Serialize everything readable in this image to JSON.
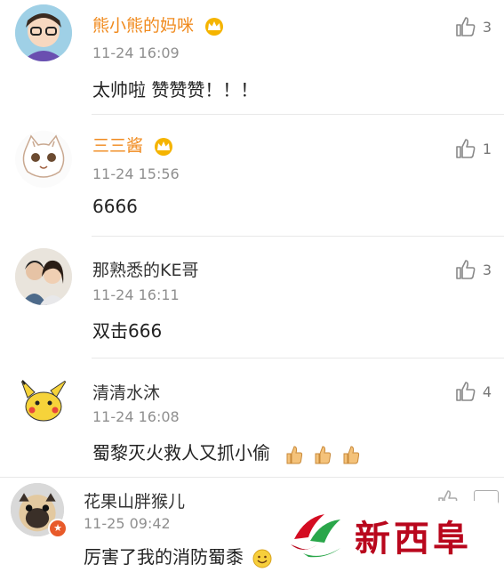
{
  "comments": [
    {
      "name": "熊小熊的妈咪",
      "vip": true,
      "time": "11-24 16:09",
      "text": "太帅啦 赞赞赞！！！",
      "likes": "3"
    },
    {
      "name": "三三酱",
      "vip": true,
      "time": "11-24 15:56",
      "text": "6666",
      "likes": "1"
    },
    {
      "name": "那熟悉的KE哥",
      "vip": false,
      "time": "11-24 16:11",
      "text": "双击666",
      "likes": "3"
    },
    {
      "name": "清清水沐",
      "vip": false,
      "time": "11-24 16:08",
      "text": "蜀黎灭火救人又抓小偷",
      "likes": "4"
    },
    {
      "name": "花果山胖猴儿",
      "vip": false,
      "time": "11-25 09:42",
      "text": "厉害了我的消防蜀黍",
      "likes": ""
    }
  ],
  "watermark": {
    "text": "新西阜"
  },
  "colors": {
    "vip_name": "#f08a1d",
    "name": "#333333",
    "time": "#8f8f8f",
    "logo": "#b9071d"
  },
  "icons": {
    "like": "thumbs-up-icon",
    "crown": "crown-icon",
    "emoji_thumb": "thumbs-up-emoji",
    "emoji_smile": "smile-emoji"
  }
}
